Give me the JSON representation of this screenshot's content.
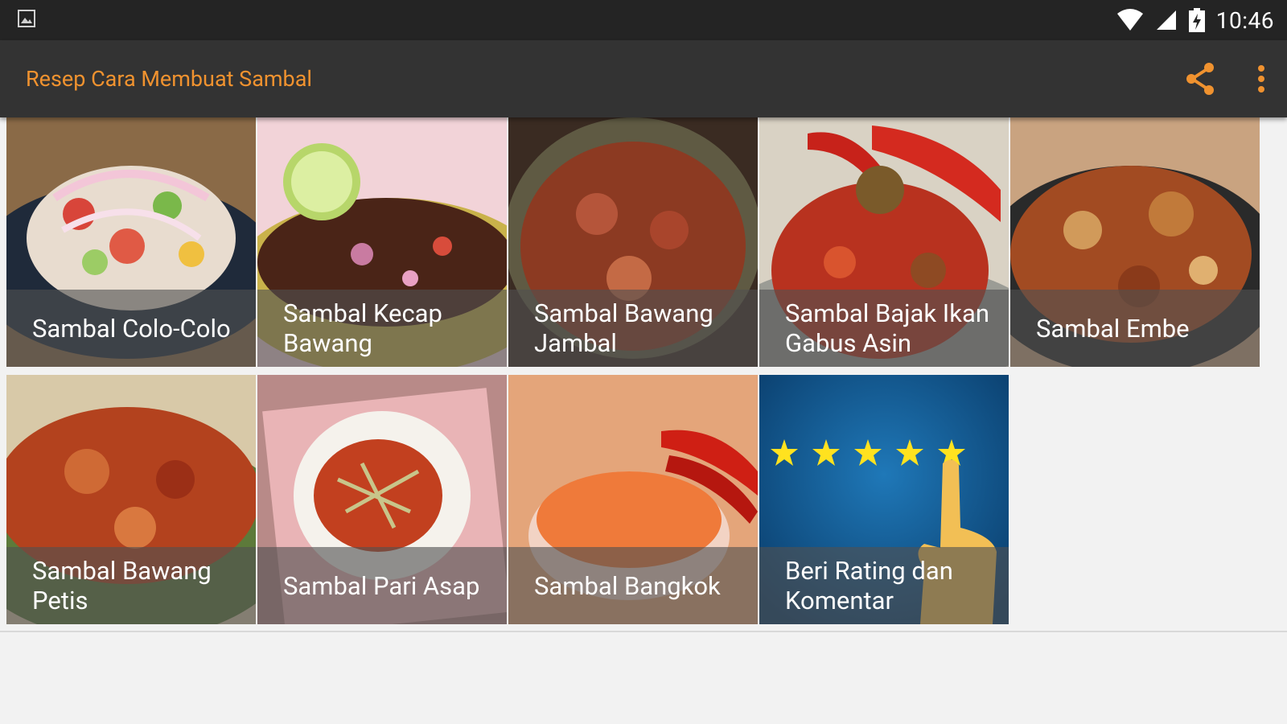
{
  "status": {
    "time": "10:46"
  },
  "app": {
    "title": "Resep Cara Membuat Sambal",
    "accent": "#f0922f"
  },
  "icons": {
    "status": [
      "picture-icon",
      "wifi-icon",
      "cell-signal-icon",
      "battery-charging-icon"
    ],
    "toolbar": [
      "share-icon",
      "overflow-menu-icon"
    ]
  },
  "recipes": [
    {
      "label": "Sambal Colo-Colo"
    },
    {
      "label": "Sambal Kecap Bawang"
    },
    {
      "label": "Sambal Bawang Jambal"
    },
    {
      "label": "Sambal Bajak Ikan Gabus Asin"
    },
    {
      "label": "Sambal Embe"
    },
    {
      "label": "Sambal Bawang Petis"
    },
    {
      "label": "Sambal Pari Asap"
    },
    {
      "label": "Sambal Bangkok"
    },
    {
      "label": "Beri Rating dan Komentar"
    }
  ]
}
